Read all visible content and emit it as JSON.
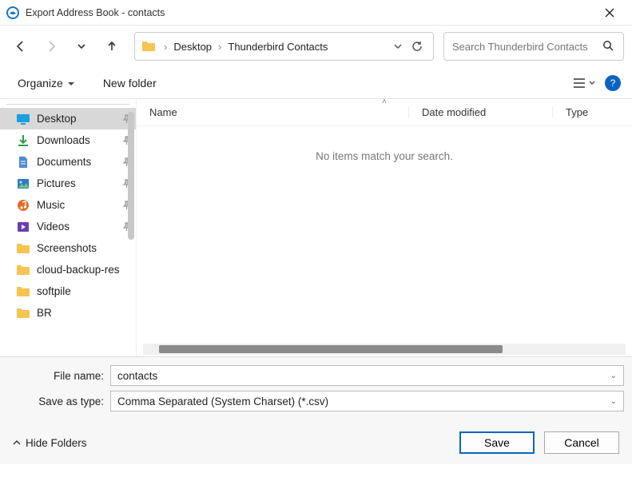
{
  "window": {
    "title": "Export Address Book - contacts"
  },
  "breadcrumb": {
    "seg1": "Desktop",
    "seg2": "Thunderbird Contacts"
  },
  "search": {
    "placeholder": "Search Thunderbird Contacts"
  },
  "toolbar": {
    "organize": "Organize",
    "new_folder": "New folder"
  },
  "columns": {
    "name": "Name",
    "date": "Date modified",
    "type": "Type"
  },
  "content": {
    "empty_msg": "No items match your search."
  },
  "sidebar": {
    "items": [
      {
        "label": "Desktop",
        "icon": "desktop",
        "pinned": true,
        "selected": true
      },
      {
        "label": "Downloads",
        "icon": "download",
        "pinned": true
      },
      {
        "label": "Documents",
        "icon": "document",
        "pinned": true
      },
      {
        "label": "Pictures",
        "icon": "pictures",
        "pinned": true
      },
      {
        "label": "Music",
        "icon": "music",
        "pinned": true
      },
      {
        "label": "Videos",
        "icon": "videos",
        "pinned": true
      },
      {
        "label": "Screenshots",
        "icon": "folder",
        "pinned": false
      },
      {
        "label": "cloud-backup-res",
        "icon": "folder",
        "pinned": false
      },
      {
        "label": "softpile",
        "icon": "folder",
        "pinned": false
      },
      {
        "label": "BR",
        "icon": "folder",
        "pinned": false
      }
    ]
  },
  "form": {
    "filename_label": "File name:",
    "filename_value": "contacts",
    "type_label": "Save as type:",
    "type_value": "Comma Separated (System Charset) (*.csv)"
  },
  "footer": {
    "hide_folders": "Hide Folders",
    "save": "Save",
    "cancel": "Cancel"
  },
  "icons": {
    "pin": "📌"
  }
}
